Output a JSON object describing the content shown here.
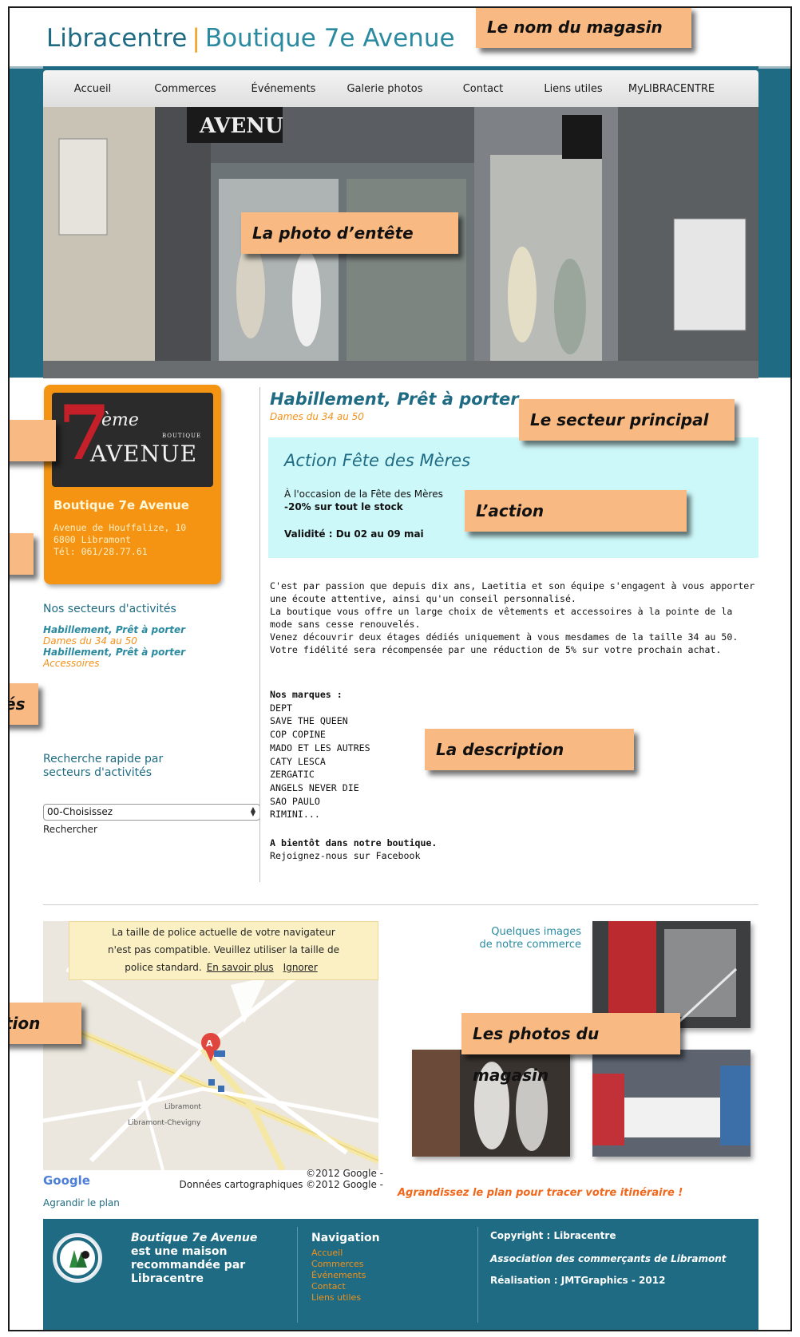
{
  "header": {
    "brand": "Libracentre",
    "separator": "|",
    "shop_title": "Boutique 7e Avenue"
  },
  "nav": {
    "items": [
      "Accueil",
      "Commerces",
      "Événements",
      "Galerie photos",
      "Contact",
      "Liens utiles",
      "MyLIBRACENTRE"
    ]
  },
  "shop_card": {
    "logo_seven": "7",
    "logo_eme": "ème",
    "logo_boutique": "BOUTIQUE",
    "logo_avenue": "AVENUE",
    "name": "Boutique 7e Avenue",
    "address_line1": "Avenue de Houffalize, 10",
    "address_line2": "6800 Libramont",
    "phone": "Tél: 061/28.77.61"
  },
  "sectors": {
    "title": "Nos secteurs d'activités",
    "items": [
      {
        "label": "Habillement, Prêt à porter",
        "kind": "main"
      },
      {
        "label": "Dames du 34 au 50",
        "kind": "sub"
      },
      {
        "label": "Habillement, Prêt à porter",
        "kind": "main"
      },
      {
        "label": "Accessoires",
        "kind": "sub"
      }
    ]
  },
  "quick_search": {
    "title": "Recherche rapide par secteurs d'activités",
    "select_value": "00-Choisissez",
    "button": "Rechercher"
  },
  "main": {
    "sector_heading": "Habillement, Prêt à  porter",
    "sector_sub": "Dames du 34 au 50",
    "action": {
      "title": "Action Fête des Mères",
      "line1": "À l'occasion de la Fête des Mères",
      "line2": "-20% sur tout le stock",
      "validity": "Validité : Du 02 au 09 mai"
    },
    "description": [
      "C'est par passion que depuis dix ans, Laetitia et son équipe s'engagent à vous apporter une écoute attentive, ainsi qu'un conseil personnalisé.",
      "La boutique vous offre un large choix de vêtements et accessoires à la pointe de la mode sans cesse renouvelés.",
      "Venez découvrir deux étages dédiés uniquement à vous mesdames de la taille 34 au 50.",
      "Votre fidélité sera récompensée par une réduction de 5% sur votre prochain achat."
    ],
    "brands_title": "Nos marques :",
    "brands": [
      "DEPT",
      "SAVE THE QUEEN",
      "COP COPINE",
      "MADO ET LES AUTRES",
      "CATY LESCA",
      "ZERGATIC",
      "ANGELS NEVER DIE",
      "SAO PAULO",
      "RIMINI..."
    ],
    "closing_bold": "A bientôt dans notre boutique.",
    "closing": "Rejoignez-nous sur Facebook"
  },
  "map": {
    "notice_line1": "La taille de police actuelle de votre navigateur",
    "notice_line2": "n'est pas compatible. Veuillez utiliser la taille de",
    "notice_line3": "police standard.",
    "notice_more": "En savoir plus",
    "notice_ignore": "Ignorer",
    "marker": "A",
    "place1": "Libramont",
    "place2": "Libramont-Chevigny",
    "copyright1": "©2012 Google -",
    "copyright2": "Données cartographiques ©2012 Google -",
    "google": "Google",
    "enlarge": "Agrandir le plan"
  },
  "gallery": {
    "label_line1": "Quelques images",
    "label_line2": "de notre commerce"
  },
  "route_cta": "Agrandissez le plan pour tracer votre itinéraire !",
  "footer": {
    "shop_name": "Boutique 7e Avenue",
    "recommended": "est une maison recommandée par Libracentre",
    "nav_title": "Navigation",
    "nav_links": [
      "Accueil",
      "Commerces",
      "Événements",
      "Contact",
      "Liens utiles"
    ],
    "copyright": "Copyright : Libracentre",
    "association": "Association des commerçants de Libramont",
    "credit": "Réalisation : JMTGraphics - 2012"
  },
  "callouts": {
    "store_name": "Le nom du magasin",
    "header_photo": "La photo d’entête",
    "main_sector": "Le secteur principal",
    "action": "L’action",
    "description": "La description",
    "store_photos": "Les photos du magasin",
    "left_sectors_fragment": "és",
    "location_fragment": "tion"
  },
  "colors": {
    "teal": "#1e6b83",
    "orange": "#f49412",
    "accent_orange": "#f39119",
    "action_bg": "#cdf8fa",
    "callout_bg": "#f9b982"
  }
}
